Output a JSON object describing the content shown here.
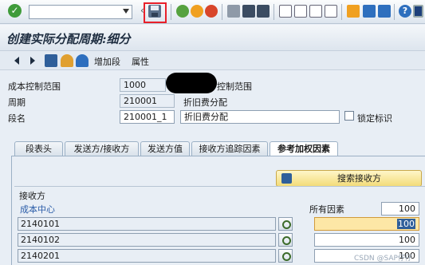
{
  "toolbar": {
    "command_value": "",
    "icons": [
      "enter-icon",
      "save-icon",
      "back-icon",
      "exit-icon",
      "cancel-icon",
      "print-icon",
      "find-icon",
      "find-next-icon",
      "first-page-icon",
      "prev-page-icon",
      "next-page-icon",
      "last-page-icon",
      "new-session-icon",
      "shortcut-icon",
      "help-icon",
      "layout-icon"
    ]
  },
  "title": "创建实际分配周期:细分",
  "app_toolbar": {
    "add_segment": "增加段",
    "attributes": "属性"
  },
  "form": {
    "controlling_area_label": "成本控制范围",
    "controlling_area_value": "1000",
    "controlling_area_desc": "控制范围",
    "cycle_label": "周期",
    "cycle_value": "210001",
    "cycle_desc": "折旧费分配",
    "segment_label": "段名",
    "segment_value": "210001_1",
    "segment_desc": "折旧费分配",
    "lock_label": "锁定标识",
    "lock_checked": false
  },
  "tabs": [
    {
      "label": "段表头",
      "active": false
    },
    {
      "label": "发送方/接收方",
      "active": false
    },
    {
      "label": "发送方值",
      "active": false
    },
    {
      "label": "接收方追踪因素",
      "active": false
    },
    {
      "label": "参考加权因素",
      "active": true
    }
  ],
  "receiver": {
    "search_button": "搜索接收方",
    "group_title": "接收方",
    "col_cost_center": "成本中心",
    "col_all_factors": "所有因素",
    "total": "100",
    "rows": [
      {
        "cost_center": "2140101",
        "factor": "100"
      },
      {
        "cost_center": "2140102",
        "factor": "100"
      },
      {
        "cost_center": "2140201",
        "factor": "100"
      }
    ]
  },
  "watermark": "CSDN @SAP仔仔"
}
